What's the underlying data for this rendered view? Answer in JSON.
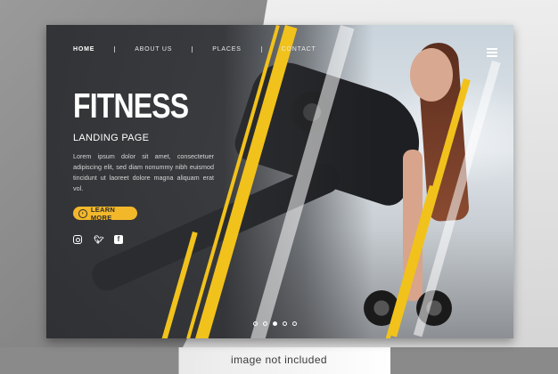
{
  "nav": {
    "items": [
      {
        "label": "HOME",
        "active": true
      },
      {
        "label": "ABOUT US",
        "active": false
      },
      {
        "label": "PLACES",
        "active": false
      },
      {
        "label": "CONTACT",
        "active": false
      }
    ]
  },
  "hero": {
    "title": "FITNESS",
    "subtitle": "LANDING PAGE",
    "description": "Lorem ipsum dolor sit amet, consectetuer adipiscing elit, sed diam nonummy nibh euismod tincidunt ut laoreet dolore magna aliquam erat vol.",
    "cta_label": "LEARN MORE"
  },
  "social": [
    "instagram-icon",
    "twitter-icon",
    "facebook-icon"
  ],
  "slider": {
    "count": 5,
    "active_index": 2
  },
  "caption": "image not included",
  "colors": {
    "accent": "#f3b82a",
    "stripe": "#f1c21b",
    "panel": "#3c3d40"
  }
}
